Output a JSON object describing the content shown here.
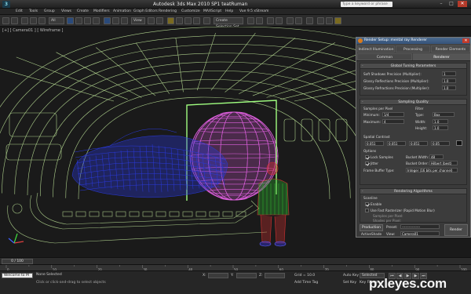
{
  "window": {
    "title": "Autodesk 3ds Max 2010 SP1     teatRuman",
    "search_placeholder": "Type a keyword or phrase",
    "minimize": "–",
    "maximize": "□",
    "close": "✕"
  },
  "menu": [
    "Edit",
    "Tools",
    "Group",
    "Views",
    "Create",
    "Modifiers",
    "Animation",
    "Graph Editors",
    "Rendering",
    "Customize",
    "MAXScript",
    "Help",
    "Vue 9.5 xStream"
  ],
  "toolbar": {
    "selection_filter": "All",
    "view_dropdown": "View",
    "named_selection": "Create Selection Set"
  },
  "viewport": {
    "label": "[+] [ Camera01 ] [ Wireframe ]",
    "colors": {
      "tunnel": "#c8f0a0",
      "car": "#2a3ae0",
      "sphere": "#e060e0",
      "figure_body": "#d03030",
      "figure_detail": "#30b030",
      "frame": "#a0ff80"
    }
  },
  "render_setup": {
    "title": "Render Setup: mental ray Renderer",
    "tabs": [
      "Indirect Illumination",
      "Processing",
      "Render Elements",
      "Common",
      "Renderer"
    ],
    "global_tuning": {
      "header": "Global Tuning Parameters",
      "rows": [
        {
          "label": "Soft Shadows Precision (Multiplier):",
          "value": "1"
        },
        {
          "label": "Glossy Reflections Precision (Multiplier):",
          "value": "1.0"
        },
        {
          "label": "Glossy Refractions Precision (Multiplier):",
          "value": "1.0"
        }
      ]
    },
    "sampling": {
      "header": "Sampling Quality",
      "samples_per_pixel": "Samples per Pixel",
      "minimum_label": "Minimum:",
      "minimum_value": "1/4",
      "maximum_label": "Maximum:",
      "maximum_value": "4",
      "filter_label": "Filter",
      "type_label": "Type:",
      "type_value": "Box",
      "width_label": "Width:",
      "width_value": "1.0",
      "height_label": "Height:",
      "height_value": "1.0",
      "spatial_contrast": "Spatial Contrast",
      "contrast_values": [
        "0.051",
        "0.051",
        "0.051",
        "0.05"
      ],
      "options": "Options",
      "lock_samples": "Lock Samples",
      "jitter": "Jitter",
      "bucket_width_label": "Bucket Width:",
      "bucket_width_value": "48",
      "bucket_order_label": "Bucket Order:",
      "bucket_order_value": "Hilbert (best)",
      "frame_buffer_label": "Frame Buffer Type:",
      "frame_buffer_value": "Integer (16 bits per channel)"
    },
    "algorithms": {
      "header": "Rendering Algorithms",
      "scanline": "Scanline",
      "enable": "Enable",
      "fast_rasterizer": "Use Fast Rasterizer (Rapid Motion Blur)",
      "samples_per_pixel": "Samples per Pixel:",
      "shades_per_pixel": "Shades per Pixel:"
    },
    "footer": {
      "mode": "Production",
      "preset_label": "Preset:",
      "preset_value": "----------------",
      "active_shade": "ActiveShade",
      "view_label": "View:",
      "view_value": "Camera01",
      "render_button": "Render"
    }
  },
  "timeline": {
    "frame_counter": "0 / 100",
    "ticks": [
      "0",
      "10",
      "20",
      "30",
      "40",
      "50",
      "60",
      "70",
      "80",
      "90",
      "100"
    ]
  },
  "status": {
    "selection": "None Selected",
    "hint": "Click or click-and-drag to select objects",
    "x_label": "X:",
    "y_label": "Y:",
    "z_label": "Z:",
    "grid": "Grid = 10.0",
    "auto_key": "Auto Key",
    "set_key": "Set Key",
    "selected": "Selected",
    "key_filters": "Key Filters...",
    "add_time_tag": "Add Time Tag",
    "maxscript": "Welcome to M"
  },
  "watermark": "pxleyes.com"
}
